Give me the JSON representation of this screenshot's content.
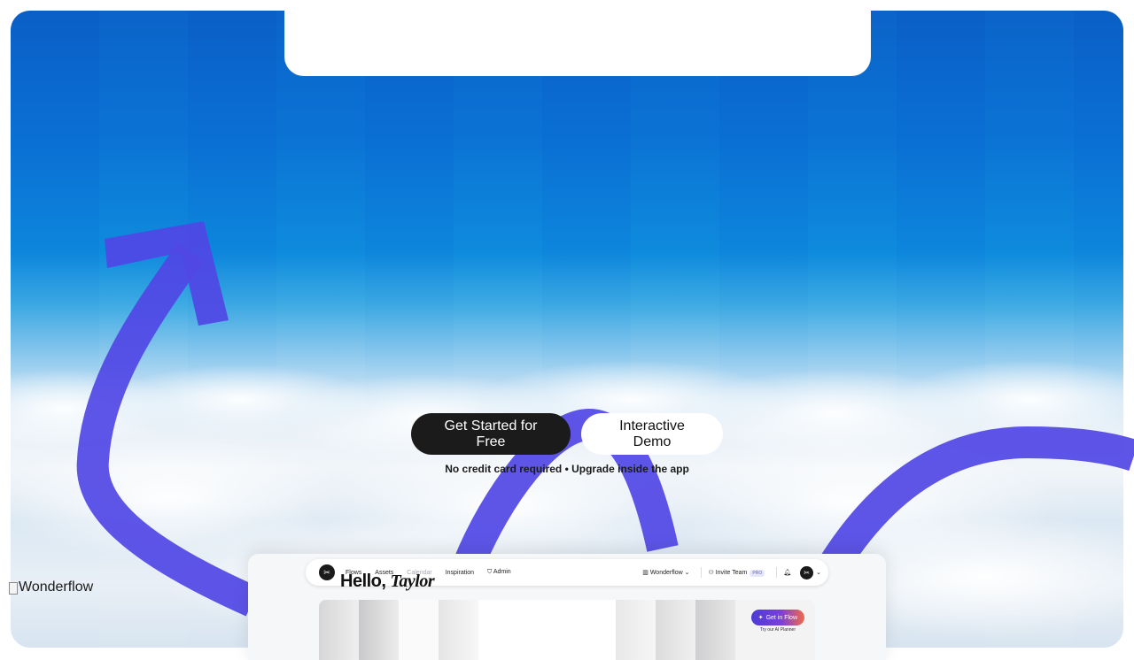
{
  "hero": {
    "cta_primary": "Get Started for Free",
    "cta_secondary": "Interactive Demo",
    "note": "No credit card required • Upgrade inside the app"
  },
  "logo": {
    "alt": "Wonderflow"
  },
  "app_preview": {
    "nav": {
      "flows": "Flows",
      "assets": "Assets",
      "calendar": "Calendar",
      "inspiration": "Inspiration",
      "admin": "Admin",
      "workspace": "Wonderflow",
      "invite": "Invite Team",
      "pro": "PRO"
    },
    "greeting_prefix": "Hello,",
    "greeting_name": "Taylor",
    "flow_button": "Get in Flow",
    "flow_sub": "Try our AI Planner"
  },
  "colors": {
    "accent_arrow": "#5046e5",
    "primary_button": "#1b1b1b",
    "sky_top": "#0a5fc6"
  }
}
